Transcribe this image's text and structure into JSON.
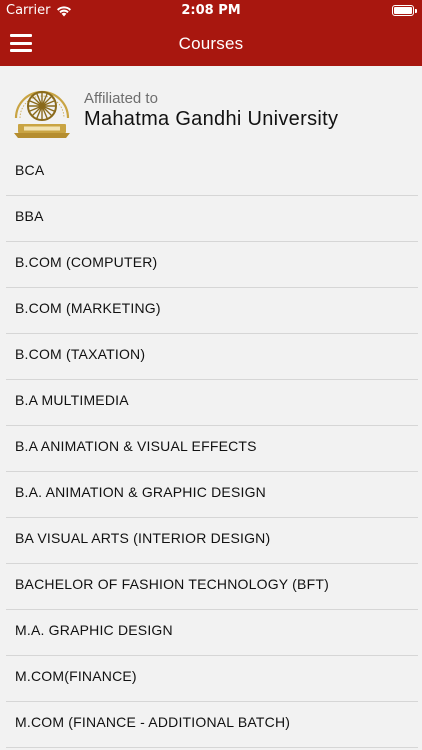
{
  "status_bar": {
    "carrier": "Carrier",
    "time": "2:08 PM"
  },
  "nav": {
    "title": "Courses",
    "menu_icon": "hamburger-menu-icon"
  },
  "header": {
    "affiliated_label": "Affiliated to",
    "university_name": "Mahatma Gandhi University",
    "logo_icon": "university-emblem-icon"
  },
  "courses": [
    {
      "label": "BCA"
    },
    {
      "label": "BBA"
    },
    {
      "label": "B.COM (COMPUTER)"
    },
    {
      "label": "B.COM (MARKETING)"
    },
    {
      "label": "B.COM (TAXATION)"
    },
    {
      "label": "B.A MULTIMEDIA"
    },
    {
      "label": "B.A ANIMATION & VISUAL EFFECTS"
    },
    {
      "label": "B.A. ANIMATION & GRAPHIC DESIGN"
    },
    {
      "label": "BA VISUAL ARTS (INTERIOR DESIGN)"
    },
    {
      "label": "BACHELOR OF FASHION TECHNOLOGY (BFT)"
    },
    {
      "label": "M.A. GRAPHIC DESIGN"
    },
    {
      "label": "M.COM(FINANCE)"
    },
    {
      "label": "M.COM (FINANCE - ADDITIONAL BATCH)"
    }
  ],
  "colors": {
    "primary": "#a8170f",
    "background": "#f2f2f2",
    "divider": "#d6d6d6",
    "emblem_gold": "#c9a443"
  }
}
